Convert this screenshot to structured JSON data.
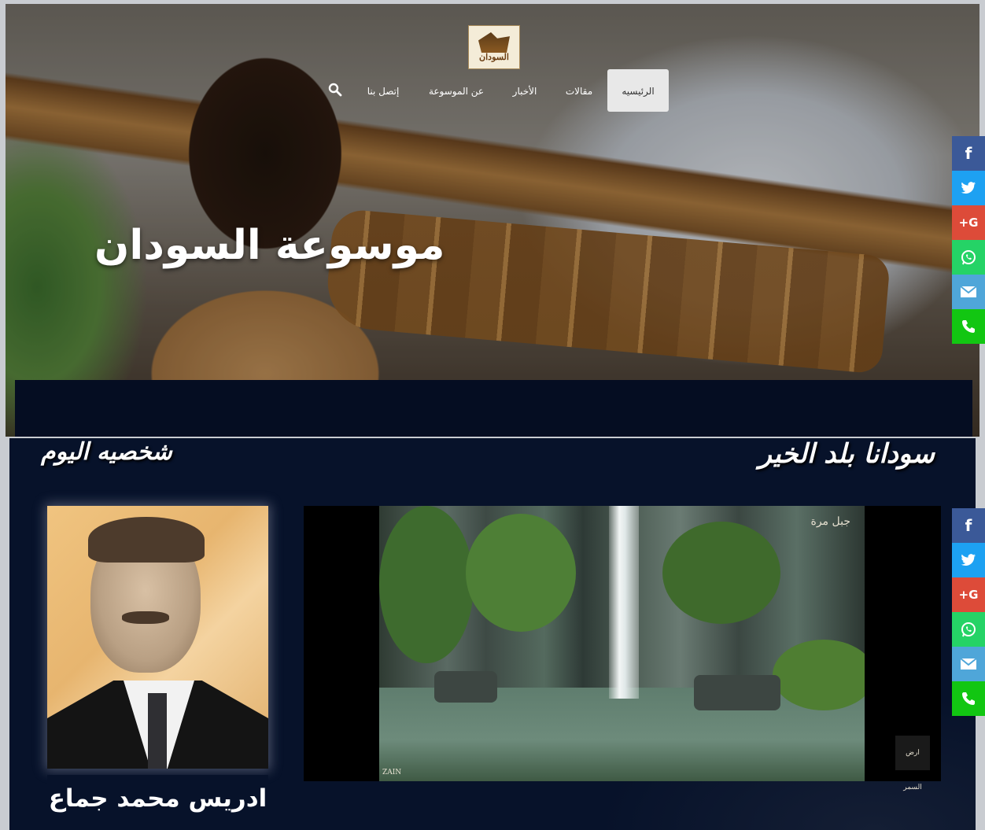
{
  "logo": {
    "text": "السودان"
  },
  "nav": {
    "items": [
      {
        "label": "الرئيسيه",
        "active": true
      },
      {
        "label": "مقالات"
      },
      {
        "label": "الأخبار"
      },
      {
        "label": "عن الموسوعة"
      },
      {
        "label": "إتصل بنا"
      }
    ],
    "search_icon": "search-icon"
  },
  "hero": {
    "title": "موسوعة السودان"
  },
  "sections": {
    "video_title": "سودانا بلد الخير",
    "person_title": "شخصيه اليوم"
  },
  "video": {
    "watermark_top": "جبل مرة",
    "watermark_bottom": "ارض السمر",
    "brand": "ZAIN"
  },
  "person": {
    "name": "ادريس محمد جماع"
  },
  "share": {
    "buttons": [
      {
        "icon": "facebook-icon",
        "glyph": "f",
        "color": "#3b5998"
      },
      {
        "icon": "twitter-icon",
        "glyph": "t",
        "color": "#1da1f2"
      },
      {
        "icon": "google-plus-icon",
        "glyph": "G+",
        "color": "#dd4b39"
      },
      {
        "icon": "whatsapp-icon",
        "glyph": "w",
        "color": "#25d366"
      },
      {
        "icon": "email-icon",
        "glyph": "m",
        "color": "#4fa6d9"
      },
      {
        "icon": "phone-icon",
        "glyph": "p",
        "color": "#12c612"
      }
    ]
  }
}
